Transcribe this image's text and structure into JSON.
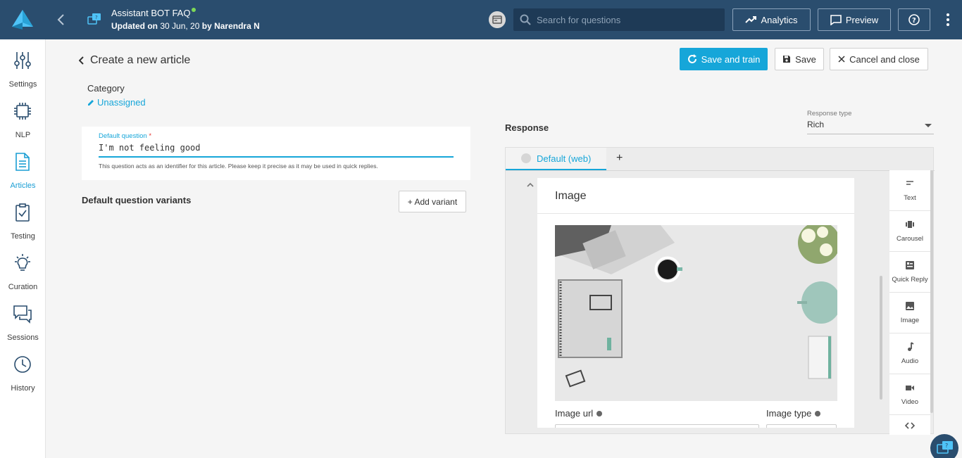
{
  "topbar": {
    "bot_title": "Assistant BOT FAQ",
    "updated_prefix": "Updated on",
    "updated_date": "30 Jun, 20",
    "updated_by": "by Narendra N",
    "search_placeholder": "Search for questions",
    "analytics_label": "Analytics",
    "preview_label": "Preview",
    "status_color": "#7ed957"
  },
  "sidebar": {
    "items": [
      {
        "label": "Settings",
        "icon": "sliders-icon"
      },
      {
        "label": "NLP",
        "icon": "chip-icon"
      },
      {
        "label": "Articles",
        "icon": "document-icon"
      },
      {
        "label": "Testing",
        "icon": "clipboard-check-icon"
      },
      {
        "label": "Curation",
        "icon": "lightbulb-icon"
      },
      {
        "label": "Sessions",
        "icon": "chat-bubbles-icon"
      },
      {
        "label": "History",
        "icon": "clock-icon"
      }
    ],
    "active": "Articles"
  },
  "page": {
    "title": "Create a new article",
    "save_train_label": "Save and train",
    "save_label": "Save",
    "cancel_label": "Cancel and close"
  },
  "category": {
    "label": "Category",
    "value": "Unassigned"
  },
  "default_question": {
    "label": "Default question",
    "required_mark": "*",
    "value": "I'm not feeling good",
    "help": "This question acts as an identifier for this article. Please keep it precise as it may be used in quick replies."
  },
  "variants": {
    "label": "Default question variants",
    "add_label": "+ Add variant"
  },
  "response": {
    "label": "Response",
    "type_label": "Response type",
    "type_value": "Rich",
    "tab_label": "Default (web)",
    "add_tab": "+",
    "card_title": "Image",
    "image_url_label": "Image url",
    "image_type_label": "Image type"
  },
  "tools": [
    {
      "label": "Text",
      "icon": "text-icon"
    },
    {
      "label": "Carousel",
      "icon": "carousel-icon"
    },
    {
      "label": "Quick Reply",
      "icon": "quick-reply-icon"
    },
    {
      "label": "Image",
      "icon": "image-icon"
    },
    {
      "label": "Audio",
      "icon": "music-note-icon"
    },
    {
      "label": "Video",
      "icon": "video-camera-icon"
    },
    {
      "label": "",
      "icon": "code-icon"
    }
  ],
  "colors": {
    "accent": "#16a6d9",
    "topbar": "#2a4d6e"
  }
}
